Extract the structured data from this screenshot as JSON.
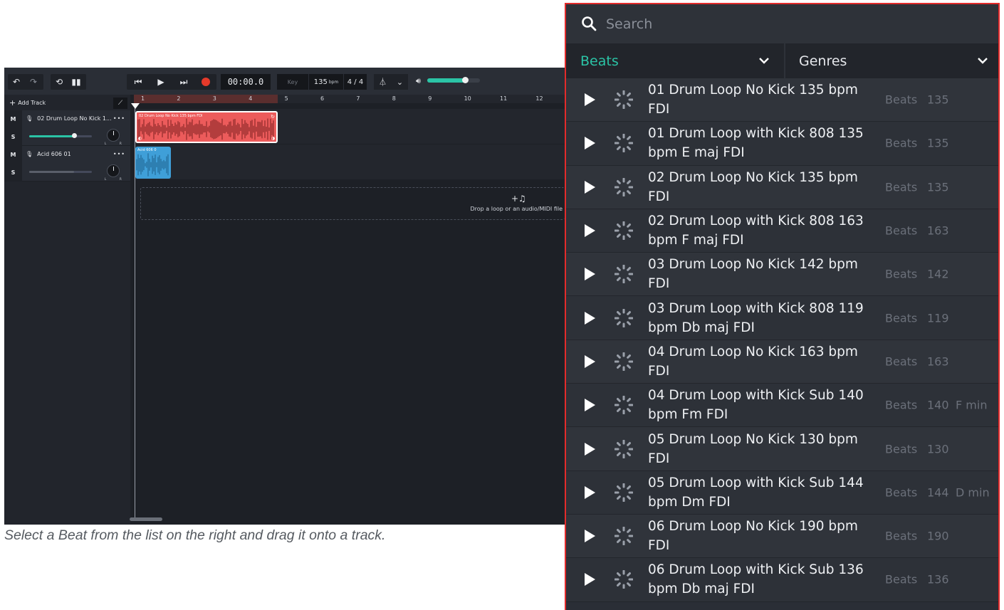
{
  "daw": {
    "time": "00:00.0",
    "key_label": "Key",
    "bpm_value": "135",
    "bpm_unit": "bpm",
    "time_signature": "4 / 4",
    "master_volume": 0.72,
    "add_track_label": "Add Track",
    "ruler_bars": [
      "1",
      "2",
      "3",
      "4",
      "5",
      "6",
      "7",
      "8",
      "9",
      "10",
      "11",
      "12"
    ],
    "tracks": [
      {
        "mute": "M",
        "solo": "S",
        "name": "02 Drum Loop No Kick 1...",
        "more": "•••",
        "volume": 0.72,
        "pan_l": "L",
        "pan_r": "R",
        "clip_title": "02 Drum Loop No Kick 135 bpm FDI",
        "clip_color": "#ec5b5b"
      },
      {
        "mute": "M",
        "solo": "S",
        "name": "Acid 606 01",
        "more": "•••",
        "volume": 0.72,
        "pan_l": "L",
        "pan_r": "R",
        "clip_title": "Acid 606 0",
        "clip_color": "#3f9fd8"
      }
    ],
    "drop_zone_text": "Drop a loop or an audio/MIDI file",
    "accent_color": "#2bc4a6"
  },
  "caption": "Select a Beat from the list on the right and drag it onto a track.",
  "browser": {
    "search_placeholder": "Search",
    "filter_category": "Beats",
    "filter_genre": "Genres",
    "accent_color": "#2bc4a6",
    "items": [
      {
        "name": "01 Drum Loop No Kick 135 bpm FDI",
        "category": "Beats",
        "bpm": "135",
        "key": ""
      },
      {
        "name": "01 Drum Loop with Kick 808 135 bpm E maj FDI",
        "category": "Beats",
        "bpm": "135",
        "key": ""
      },
      {
        "name": "02 Drum Loop No Kick 135 bpm FDI",
        "category": "Beats",
        "bpm": "135",
        "key": ""
      },
      {
        "name": "02 Drum Loop with Kick 808 163 bpm F maj FDI",
        "category": "Beats",
        "bpm": "163",
        "key": ""
      },
      {
        "name": "03 Drum Loop No Kick 142 bpm FDI",
        "category": "Beats",
        "bpm": "142",
        "key": ""
      },
      {
        "name": "03 Drum Loop with Kick 808 119 bpm Db maj FDI",
        "category": "Beats",
        "bpm": "119",
        "key": ""
      },
      {
        "name": "04 Drum Loop No Kick 163 bpm FDI",
        "category": "Beats",
        "bpm": "163",
        "key": ""
      },
      {
        "name": "04 Drum Loop with Kick Sub 140 bpm Fm FDI",
        "category": "Beats",
        "bpm": "140",
        "key": "F min"
      },
      {
        "name": "05 Drum Loop No Kick 130 bpm FDI",
        "category": "Beats",
        "bpm": "130",
        "key": ""
      },
      {
        "name": "05 Drum Loop with Kick Sub 144 bpm Dm FDI",
        "category": "Beats",
        "bpm": "144",
        "key": "D min"
      },
      {
        "name": "06 Drum Loop No Kick 190 bpm FDI",
        "category": "Beats",
        "bpm": "190",
        "key": ""
      },
      {
        "name": "06 Drum Loop with Kick Sub 136 bpm Db maj FDI",
        "category": "Beats",
        "bpm": "136",
        "key": ""
      }
    ]
  }
}
